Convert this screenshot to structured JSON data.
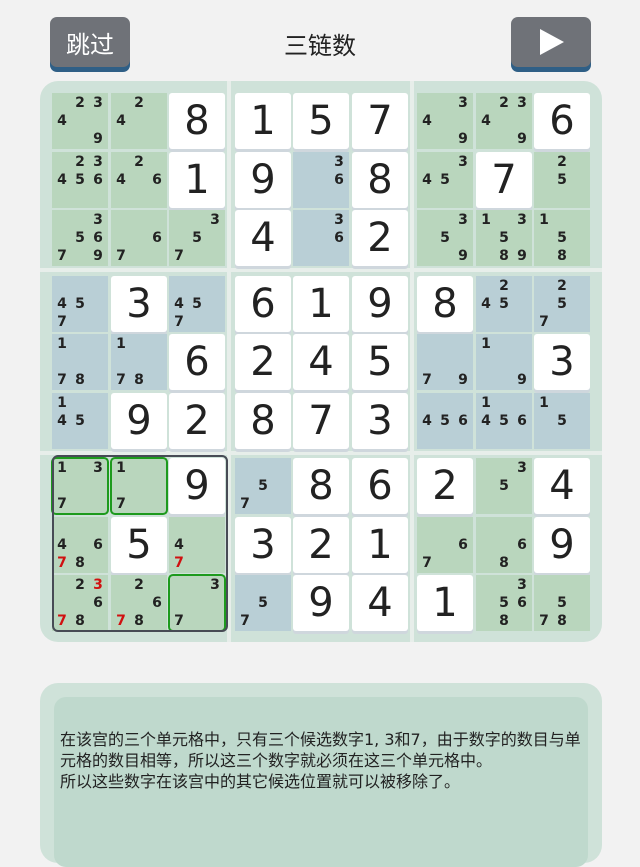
{
  "header": {
    "skip_label": "跳过",
    "title": "三链数",
    "play_icon": "play-icon"
  },
  "grid": {
    "givens": [
      [
        0,
        0,
        0,
        8,
        1,
        5,
        7,
        0,
        0,
        6
      ],
      [
        0,
        0,
        0,
        1,
        9,
        0,
        8,
        0,
        7,
        0
      ],
      [
        0,
        0,
        0,
        0,
        4,
        0,
        2,
        0,
        0,
        0
      ],
      [
        0,
        3,
        0,
        6,
        1,
        9,
        8,
        0,
        0,
        0
      ],
      [
        0,
        0,
        6,
        2,
        4,
        5,
        0,
        0,
        3,
        0
      ],
      [
        0,
        9,
        2,
        8,
        7,
        3,
        0,
        0,
        0,
        0
      ],
      [
        0,
        0,
        9,
        0,
        8,
        6,
        2,
        0,
        4,
        0
      ],
      [
        0,
        5,
        0,
        3,
        2,
        1,
        0,
        0,
        9,
        0
      ],
      [
        0,
        0,
        0,
        0,
        9,
        4,
        1,
        0,
        0,
        0
      ]
    ],
    "rows": [
      [
        "0,0,0,8,1,5,7,0,0,6"
      ]
    ]
  },
  "hint": {
    "line1": "在该宫的三个单元格中，只有三个候选数字1, 3和7，由于数字的数目与单元格的数目相等，所以这三个数字就必须在这三个单元格中。",
    "line2": "所以这些数字在该宫中的其它候选位置就可以被移除了。"
  }
}
